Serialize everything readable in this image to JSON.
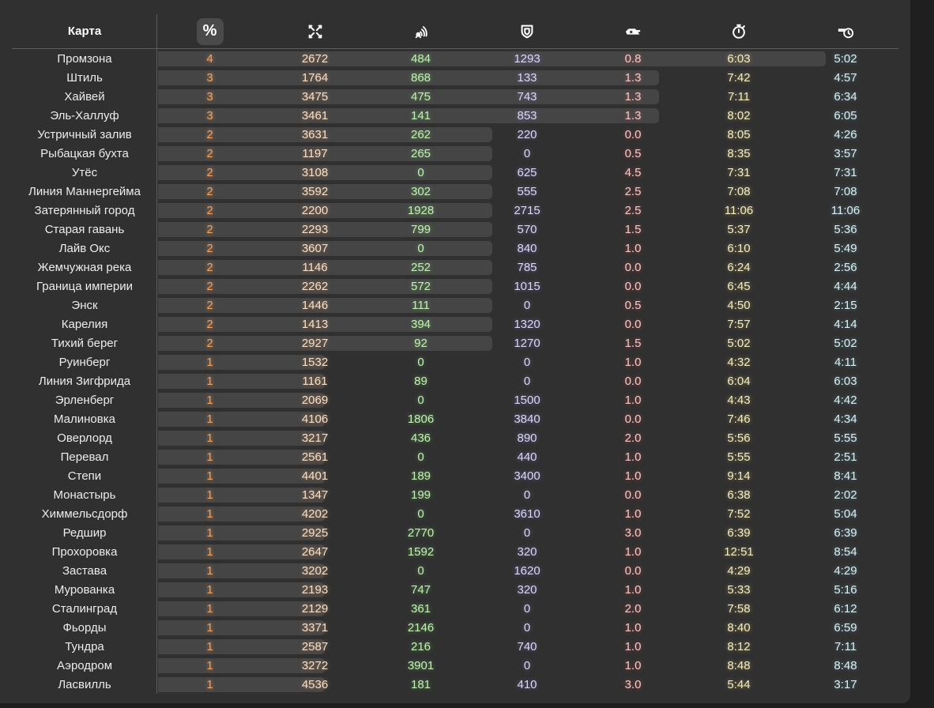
{
  "header": {
    "map_label": "Карта",
    "sort_label": "%",
    "icons": [
      "damage-icon",
      "radio-assist-icon",
      "shield-icon",
      "tank-kill-icon",
      "stopwatch-icon",
      "tank-clock-icon"
    ]
  },
  "colors": {
    "background": "#303030",
    "percent": "#f5a25e",
    "damage": "#f6e0c8",
    "assist": "#c4f0b2",
    "blocked": "#dad8f5",
    "kills": "#f3c9c9",
    "time": "#f3edc2",
    "alive": "#d9f1f6"
  },
  "rows": [
    {
      "name": "Промзона",
      "pct": "4",
      "dmg": "2672",
      "assist": "484",
      "block": "1293",
      "kd": "0.8",
      "time": "6:03",
      "alive": "5:02",
      "bar": 1.0
    },
    {
      "name": "Штиль",
      "pct": "3",
      "dmg": "1764",
      "assist": "868",
      "block": "133",
      "kd": "1.3",
      "time": "7:42",
      "alive": "4:57",
      "bar": 0.75
    },
    {
      "name": "Хайвей",
      "pct": "3",
      "dmg": "3475",
      "assist": "475",
      "block": "743",
      "kd": "1.3",
      "time": "7:11",
      "alive": "6:34",
      "bar": 0.75
    },
    {
      "name": "Эль-Халлуф",
      "pct": "3",
      "dmg": "3461",
      "assist": "141",
      "block": "853",
      "kd": "1.3",
      "time": "8:02",
      "alive": "6:05",
      "bar": 0.75
    },
    {
      "name": "Устричный залив",
      "pct": "2",
      "dmg": "3631",
      "assist": "262",
      "block": "220",
      "kd": "0.0",
      "time": "8:05",
      "alive": "4:26",
      "bar": 0.5
    },
    {
      "name": "Рыбацкая бухта",
      "pct": "2",
      "dmg": "1197",
      "assist": "265",
      "block": "0",
      "kd": "0.5",
      "time": "8:35",
      "alive": "3:57",
      "bar": 0.5
    },
    {
      "name": "Утёс",
      "pct": "2",
      "dmg": "3108",
      "assist": "0",
      "block": "625",
      "kd": "4.5",
      "time": "7:31",
      "alive": "7:31",
      "bar": 0.5
    },
    {
      "name": "Линия Маннергейма",
      "pct": "2",
      "dmg": "3592",
      "assist": "302",
      "block": "555",
      "kd": "2.5",
      "time": "7:08",
      "alive": "7:08",
      "bar": 0.5
    },
    {
      "name": "Затерянный город",
      "pct": "2",
      "dmg": "2200",
      "assist": "1928",
      "block": "2715",
      "kd": "2.5",
      "time": "11:06",
      "alive": "11:06",
      "bar": 0.5
    },
    {
      "name": "Старая гавань",
      "pct": "2",
      "dmg": "2293",
      "assist": "799",
      "block": "570",
      "kd": "1.5",
      "time": "5:37",
      "alive": "5:36",
      "bar": 0.5
    },
    {
      "name": "Лайв Окс",
      "pct": "2",
      "dmg": "3607",
      "assist": "0",
      "block": "840",
      "kd": "1.0",
      "time": "6:10",
      "alive": "5:49",
      "bar": 0.5
    },
    {
      "name": "Жемчужная река",
      "pct": "2",
      "dmg": "1146",
      "assist": "252",
      "block": "785",
      "kd": "0.0",
      "time": "6:24",
      "alive": "2:56",
      "bar": 0.5
    },
    {
      "name": "Граница империи",
      "pct": "2",
      "dmg": "2262",
      "assist": "572",
      "block": "1015",
      "kd": "0.0",
      "time": "6:45",
      "alive": "4:44",
      "bar": 0.5
    },
    {
      "name": "Энск",
      "pct": "2",
      "dmg": "1446",
      "assist": "111",
      "block": "0",
      "kd": "0.5",
      "time": "4:50",
      "alive": "2:15",
      "bar": 0.5
    },
    {
      "name": "Карелия",
      "pct": "2",
      "dmg": "1413",
      "assist": "394",
      "block": "1320",
      "kd": "0.0",
      "time": "7:57",
      "alive": "4:14",
      "bar": 0.5
    },
    {
      "name": "Тихий берег",
      "pct": "2",
      "dmg": "2927",
      "assist": "92",
      "block": "1270",
      "kd": "1.5",
      "time": "5:02",
      "alive": "5:02",
      "bar": 0.5
    },
    {
      "name": "Руинберг",
      "pct": "1",
      "dmg": "1532",
      "assist": "0",
      "block": "0",
      "kd": "1.0",
      "time": "4:32",
      "alive": "4:11",
      "bar": 0.25
    },
    {
      "name": "Линия Зигфрида",
      "pct": "1",
      "dmg": "1161",
      "assist": "89",
      "block": "0",
      "kd": "0.0",
      "time": "6:04",
      "alive": "6:03",
      "bar": 0.25
    },
    {
      "name": "Эрленберг",
      "pct": "1",
      "dmg": "2069",
      "assist": "0",
      "block": "1500",
      "kd": "1.0",
      "time": "4:43",
      "alive": "4:42",
      "bar": 0.25
    },
    {
      "name": "Малиновка",
      "pct": "1",
      "dmg": "4106",
      "assist": "1806",
      "block": "3840",
      "kd": "0.0",
      "time": "7:46",
      "alive": "4:34",
      "bar": 0.25
    },
    {
      "name": "Оверлорд",
      "pct": "1",
      "dmg": "3217",
      "assist": "436",
      "block": "890",
      "kd": "2.0",
      "time": "5:56",
      "alive": "5:55",
      "bar": 0.25
    },
    {
      "name": "Перевал",
      "pct": "1",
      "dmg": "2561",
      "assist": "0",
      "block": "440",
      "kd": "1.0",
      "time": "5:55",
      "alive": "2:51",
      "bar": 0.25
    },
    {
      "name": "Степи",
      "pct": "1",
      "dmg": "4401",
      "assist": "189",
      "block": "3400",
      "kd": "1.0",
      "time": "9:14",
      "alive": "8:41",
      "bar": 0.25
    },
    {
      "name": "Монастырь",
      "pct": "1",
      "dmg": "1347",
      "assist": "199",
      "block": "0",
      "kd": "0.0",
      "time": "6:38",
      "alive": "2:02",
      "bar": 0.25
    },
    {
      "name": "Химмельсдорф",
      "pct": "1",
      "dmg": "4202",
      "assist": "0",
      "block": "3610",
      "kd": "1.0",
      "time": "7:52",
      "alive": "5:04",
      "bar": 0.25
    },
    {
      "name": "Редшир",
      "pct": "1",
      "dmg": "2925",
      "assist": "2770",
      "block": "0",
      "kd": "3.0",
      "time": "6:39",
      "alive": "6:39",
      "bar": 0.25
    },
    {
      "name": "Прохоровка",
      "pct": "1",
      "dmg": "2647",
      "assist": "1592",
      "block": "320",
      "kd": "1.0",
      "time": "12:51",
      "alive": "8:54",
      "bar": 0.25
    },
    {
      "name": "Застава",
      "pct": "1",
      "dmg": "3202",
      "assist": "0",
      "block": "1620",
      "kd": "0.0",
      "time": "4:29",
      "alive": "4:29",
      "bar": 0.25
    },
    {
      "name": "Мурованка",
      "pct": "1",
      "dmg": "2193",
      "assist": "747",
      "block": "320",
      "kd": "1.0",
      "time": "5:33",
      "alive": "5:16",
      "bar": 0.25
    },
    {
      "name": "Сталинград",
      "pct": "1",
      "dmg": "2129",
      "assist": "361",
      "block": "0",
      "kd": "2.0",
      "time": "7:58",
      "alive": "6:12",
      "bar": 0.25
    },
    {
      "name": "Фьорды",
      "pct": "1",
      "dmg": "3371",
      "assist": "2146",
      "block": "0",
      "kd": "1.0",
      "time": "8:40",
      "alive": "6:59",
      "bar": 0.25
    },
    {
      "name": "Тундра",
      "pct": "1",
      "dmg": "2587",
      "assist": "216",
      "block": "740",
      "kd": "1.0",
      "time": "8:12",
      "alive": "7:11",
      "bar": 0.25
    },
    {
      "name": "Аэродром",
      "pct": "1",
      "dmg": "3272",
      "assist": "3901",
      "block": "0",
      "kd": "1.0",
      "time": "8:48",
      "alive": "8:48",
      "bar": 0.25
    },
    {
      "name": "Ласвилль",
      "pct": "1",
      "dmg": "4536",
      "assist": "181",
      "block": "410",
      "kd": "3.0",
      "time": "5:44",
      "alive": "3:17",
      "bar": 0.25
    }
  ]
}
